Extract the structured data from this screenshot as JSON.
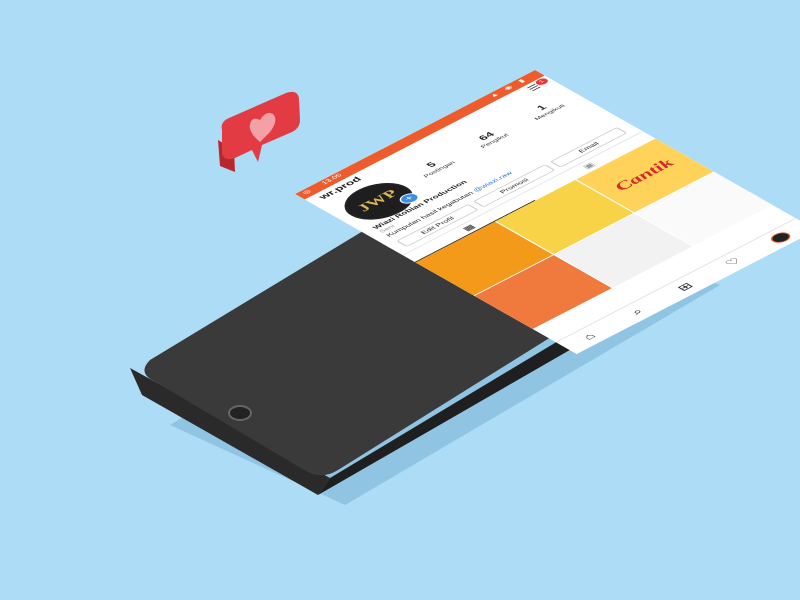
{
  "status": {
    "time": "13.05"
  },
  "profile": {
    "handle": "wr.prod",
    "avatar_text": "JWP",
    "name": "Wiazi Robian Production",
    "category": "Seni",
    "bio": "Kumpulan hasil kegabutan",
    "bio_tag": "@wiazi.raw",
    "notif_count": "1"
  },
  "stats": [
    {
      "value": "5",
      "label": "Postingan"
    },
    {
      "value": "64",
      "label": "Pengikut"
    },
    {
      "value": "1",
      "label": "Mengikuti"
    }
  ],
  "buttons": {
    "edit": "Edit Profil",
    "promo": "Promosi",
    "email": "Email"
  },
  "posts": [
    {
      "text": ""
    },
    {
      "text": ""
    },
    {
      "text": "Cantik"
    },
    {
      "text": ""
    },
    {
      "text": ""
    },
    {
      "text": ""
    }
  ],
  "colors": {
    "background": "#acdcf6",
    "accent": "#ee5b2c",
    "phone_body": "#3a3a3a",
    "like_red": "#e23b43"
  },
  "icons": [
    "home-icon",
    "search-icon",
    "add-icon",
    "heart-icon",
    "profile-icon",
    "grid-icon",
    "tagged-icon",
    "menu-icon"
  ]
}
